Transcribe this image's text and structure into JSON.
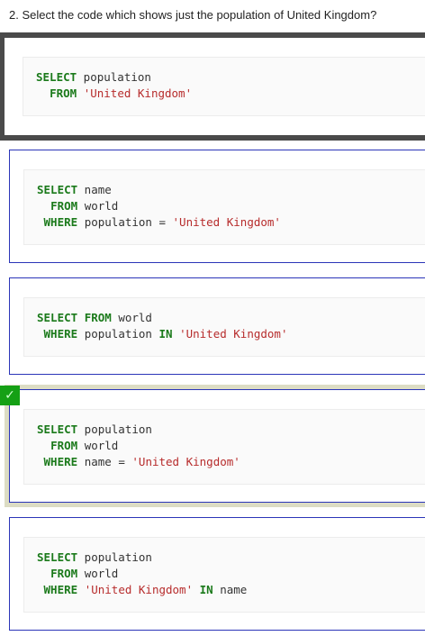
{
  "question": "2. Select the code which shows just the population of United Kingdom?",
  "options": [
    {
      "lines": [
        {
          "indent": "",
          "kw": "SELECT",
          "rest": " population"
        },
        {
          "indent": "  ",
          "kw": "FROM",
          "rest": " ",
          "str": "'United Kingdom'"
        }
      ]
    },
    {
      "lines": [
        {
          "indent": "",
          "kw": "SELECT",
          "rest": " name"
        },
        {
          "indent": "  ",
          "kw": "FROM",
          "rest": " world"
        },
        {
          "indent": " ",
          "kw": "WHERE",
          "rest": " population = ",
          "str": "'United Kingdom'"
        }
      ]
    },
    {
      "lines": [
        {
          "indent": "",
          "kw": "SELECT",
          "rest": " ",
          "kw2": "FROM",
          "rest2": " world"
        },
        {
          "indent": " ",
          "kw": "WHERE",
          "rest": " population ",
          "kw2": "IN",
          "rest2": " ",
          "str": "'United Kingdom'"
        }
      ]
    },
    {
      "lines": [
        {
          "indent": "",
          "kw": "SELECT",
          "rest": " population"
        },
        {
          "indent": "  ",
          "kw": "FROM",
          "rest": " world"
        },
        {
          "indent": " ",
          "kw": "WHERE",
          "rest": " name = ",
          "str": "'United Kingdom'"
        }
      ]
    },
    {
      "lines": [
        {
          "indent": "",
          "kw": "SELECT",
          "rest": " population"
        },
        {
          "indent": "  ",
          "kw": "FROM",
          "rest": " world"
        },
        {
          "indent": " ",
          "kw": "WHERE",
          "rest": " ",
          "str": "'United Kingdom'",
          "kw2": " IN",
          "rest2": " name"
        }
      ]
    }
  ],
  "correct_mark": "✓",
  "colors": {
    "keyword": "#1b7a1b",
    "string": "#b72c2c",
    "option_border": "#2b35b8",
    "check_bg": "#15a015"
  }
}
